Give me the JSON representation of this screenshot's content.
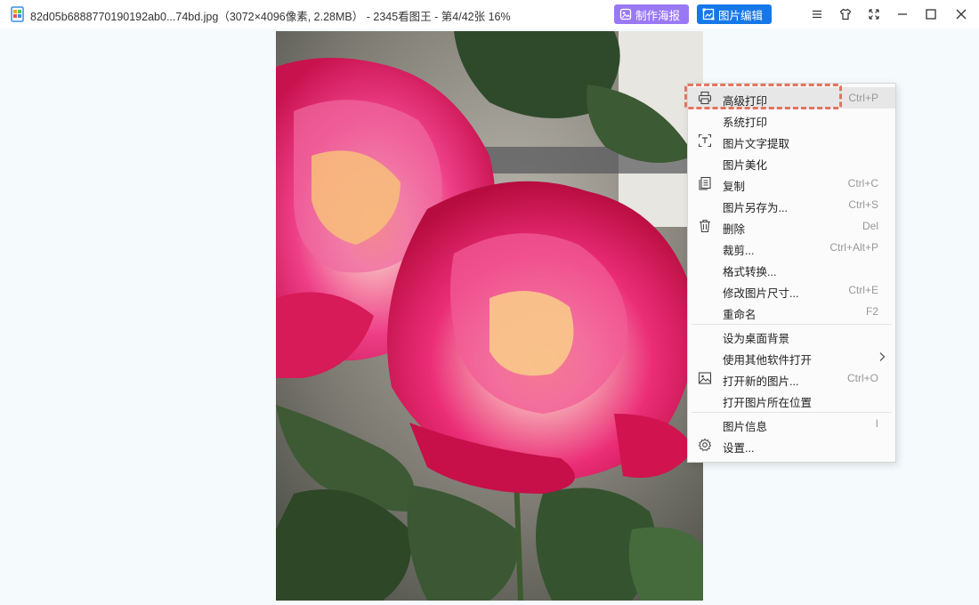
{
  "window": {
    "title": "82d05b6888770190192ab0...74bd.jpg（3072×4096像素, 2.28MB） - 2345看图王 - 第4/42张 16%"
  },
  "toolbar": {
    "poster_label": "制作海报",
    "edit_label": "图片编辑"
  },
  "menu": {
    "items": [
      {
        "label": "高级打印",
        "shortcut": "Ctrl+P",
        "icon": "printer-icon"
      },
      {
        "label": "系统打印",
        "shortcut": "",
        "icon": ""
      },
      {
        "label": "图片文字提取",
        "shortcut": "",
        "icon": "text-extract-icon"
      },
      {
        "label": "图片美化",
        "shortcut": "",
        "icon": ""
      },
      {
        "label": "复制",
        "shortcut": "Ctrl+C",
        "icon": "copy-icon"
      },
      {
        "label": "图片另存为...",
        "shortcut": "Ctrl+S",
        "icon": ""
      },
      {
        "label": "删除",
        "shortcut": "Del",
        "icon": "trash-icon"
      },
      {
        "label": "裁剪...",
        "shortcut": "Ctrl+Alt+P",
        "icon": ""
      },
      {
        "label": "格式转换...",
        "shortcut": "",
        "icon": ""
      },
      {
        "label": "修改图片尺寸...",
        "shortcut": "Ctrl+E",
        "icon": ""
      },
      {
        "label": "重命名",
        "shortcut": "F2",
        "icon": ""
      },
      {
        "label": "设为桌面背景",
        "shortcut": "",
        "icon": ""
      },
      {
        "label": "使用其他软件打开",
        "shortcut": "",
        "icon": "chevron-right-icon"
      },
      {
        "label": "打开新的图片...",
        "shortcut": "Ctrl+O",
        "icon": "image-icon"
      },
      {
        "label": "打开图片所在位置",
        "shortcut": "",
        "icon": ""
      },
      {
        "label": "图片信息",
        "shortcut": "I",
        "icon": ""
      },
      {
        "label": "设置...",
        "shortcut": "",
        "icon": "gear-icon"
      }
    ]
  },
  "colors": {
    "poster_button": "#9a78f5",
    "edit_button": "#1677e8",
    "highlight_dash": "#e07560"
  }
}
